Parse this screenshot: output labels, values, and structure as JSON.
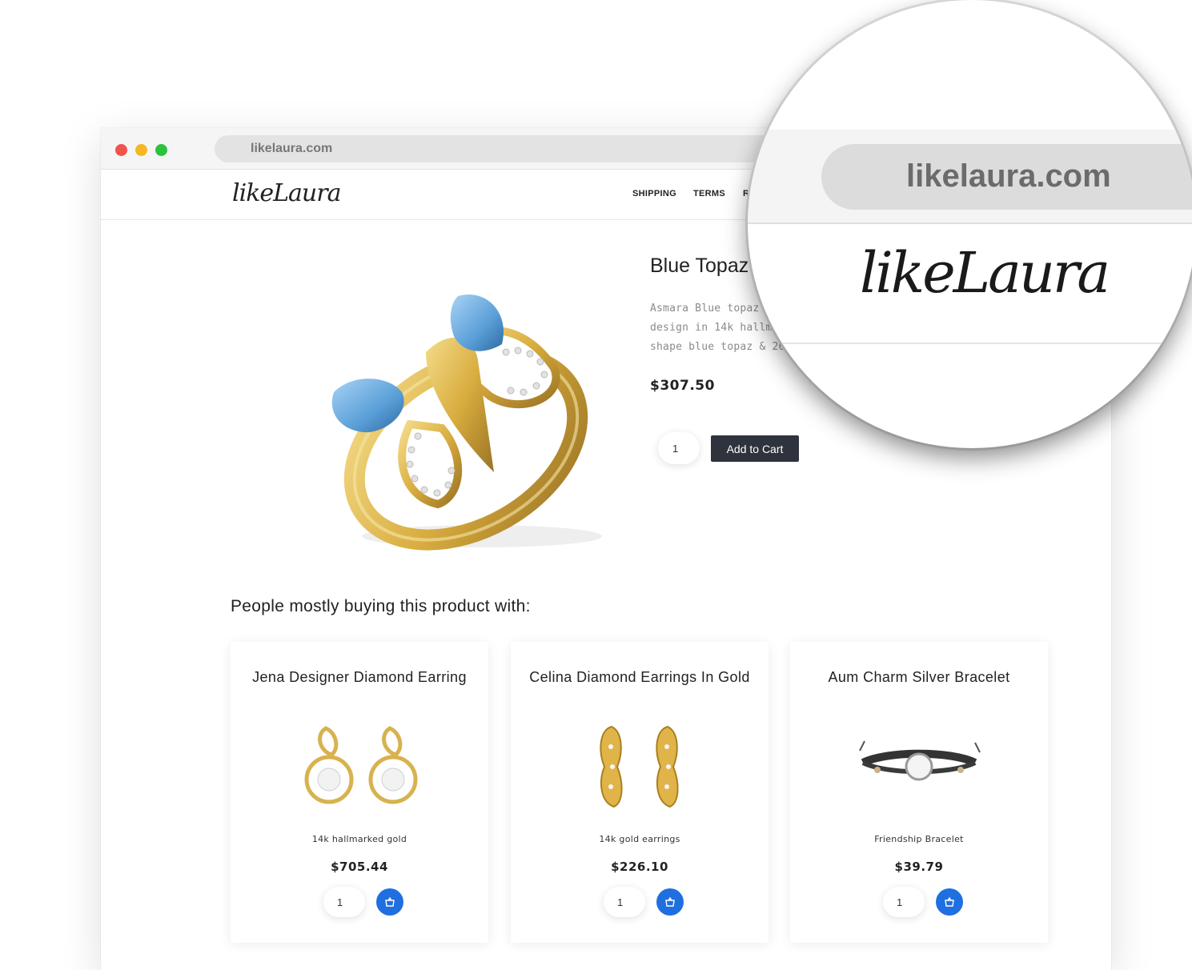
{
  "browser": {
    "url": "likelaura.com"
  },
  "header": {
    "logo": "likeLaura",
    "nav": [
      "SHIPPING",
      "TERMS",
      "RE"
    ]
  },
  "product": {
    "title": "Blue Topaz",
    "description_lines": [
      "Asmara Blue topaz & di",
      "design in 14k hallmarked",
      "shape blue topaz & 26 rou"
    ],
    "price": "$307.50",
    "quantity": "1",
    "add_to_cart_label": "Add to Cart"
  },
  "related": {
    "heading": "People mostly buying this product with:",
    "items": [
      {
        "title": "Jena Designer Diamond Earring",
        "subtitle": "14k hallmarked gold",
        "price": "$705.44",
        "quantity": "1"
      },
      {
        "title": "Celina Diamond Earrings In Gold",
        "subtitle": "14k gold earrings",
        "price": "$226.10",
        "quantity": "1"
      },
      {
        "title": "Aum Charm Silver Bracelet",
        "subtitle": "Friendship Bracelet",
        "price": "$39.79",
        "quantity": "1"
      }
    ]
  },
  "magnifier": {
    "url": "likelaura.com",
    "logo": "likeLaura"
  },
  "colors": {
    "accent_blue": "#1f6fe0",
    "cart_button": "#2f333e",
    "dot_red": "#f2534c",
    "dot_yellow": "#f6b721",
    "dot_green": "#2cc33c"
  },
  "icons": [
    "basket-icon"
  ]
}
